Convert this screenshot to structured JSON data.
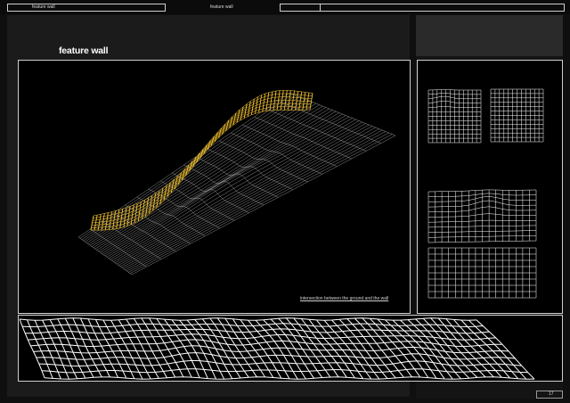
{
  "header": {
    "left_label": "feature wall",
    "center_label": "feature wall"
  },
  "page": {
    "title": "feature wall",
    "number": "17"
  },
  "main_view": {
    "caption": "intersection between the ground and the wall",
    "wall_color": "#f2c12e",
    "grid_color": "#ffffff"
  }
}
